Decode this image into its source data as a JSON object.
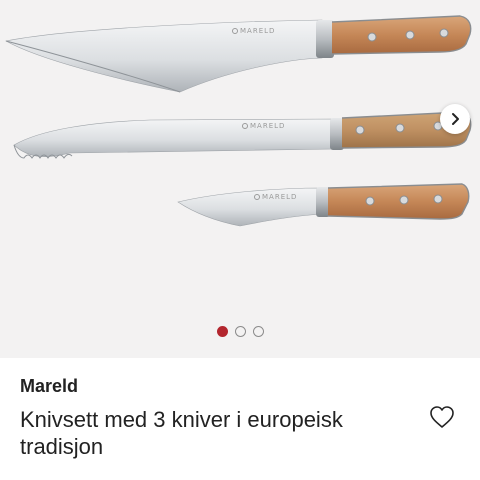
{
  "product": {
    "brand": "Mareld",
    "title": "Knivsett med 3 kniver i europeisk tradisjon",
    "blade_stamp": "MARELD"
  },
  "gallery": {
    "slide_count": 3,
    "active_slide": 1,
    "next_icon": "chevron-right-icon"
  },
  "icons": {
    "favorite": "heart-outline-icon"
  },
  "colors": {
    "gallery_background": "#f3f2f2",
    "active_dot": "#b3262e",
    "handle_wood": "#c78a5c",
    "text": "#222222"
  }
}
